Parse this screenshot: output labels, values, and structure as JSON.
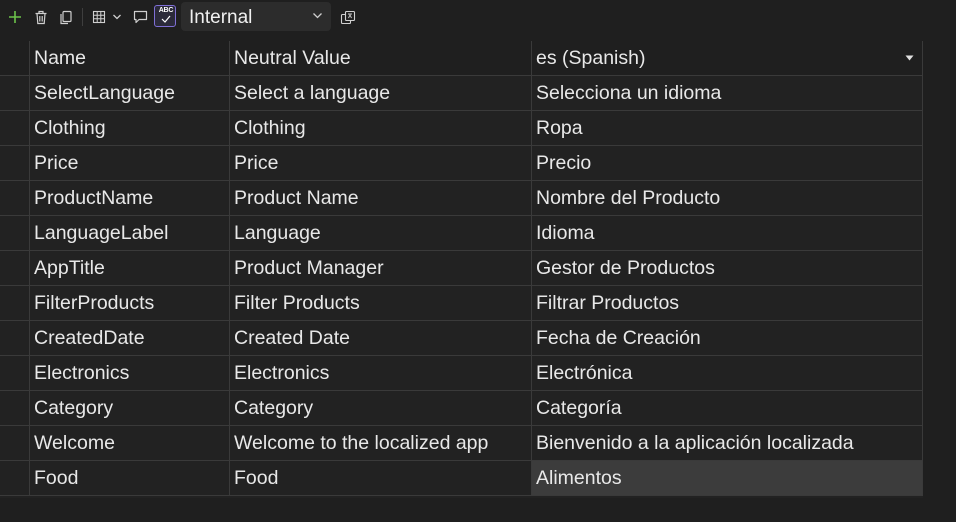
{
  "toolbar": {
    "add_icon": "plus-icon",
    "delete_icon": "trash-icon",
    "copy_icon": "copy-icon",
    "columns_icon": "grid-columns-icon",
    "comment_icon": "comment-icon",
    "spellcheck_label": "ABC",
    "access_modifier": "Internal",
    "translate_icon": "translate-icon",
    "accent_color": "#7f6fd6",
    "add_color": "#6cc24a"
  },
  "grid": {
    "headers": [
      "Name",
      "Neutral Value",
      "es (Spanish)"
    ],
    "rows": [
      {
        "name": "SelectLanguage",
        "neutral": "Select a language",
        "es": "Selecciona un idioma"
      },
      {
        "name": "Clothing",
        "neutral": "Clothing",
        "es": "Ropa"
      },
      {
        "name": "Price",
        "neutral": "Price",
        "es": "Precio"
      },
      {
        "name": "ProductName",
        "neutral": "Product Name",
        "es": "Nombre del Producto"
      },
      {
        "name": "LanguageLabel",
        "neutral": "Language",
        "es": "Idioma"
      },
      {
        "name": "AppTitle",
        "neutral": "Product Manager",
        "es": "Gestor de Productos"
      },
      {
        "name": "FilterProducts",
        "neutral": "Filter Products",
        "es": "Filtrar Productos"
      },
      {
        "name": "CreatedDate",
        "neutral": "Created Date",
        "es": "Fecha de Creación"
      },
      {
        "name": "Electronics",
        "neutral": "Electronics",
        "es": "Electrónica"
      },
      {
        "name": "Category",
        "neutral": "Category",
        "es": "Categoría"
      },
      {
        "name": "Welcome",
        "neutral": "Welcome to the localized app",
        "es": "Bienvenido a la aplicación localizada"
      },
      {
        "name": "Food",
        "neutral": "Food",
        "es": "Alimentos"
      }
    ]
  }
}
